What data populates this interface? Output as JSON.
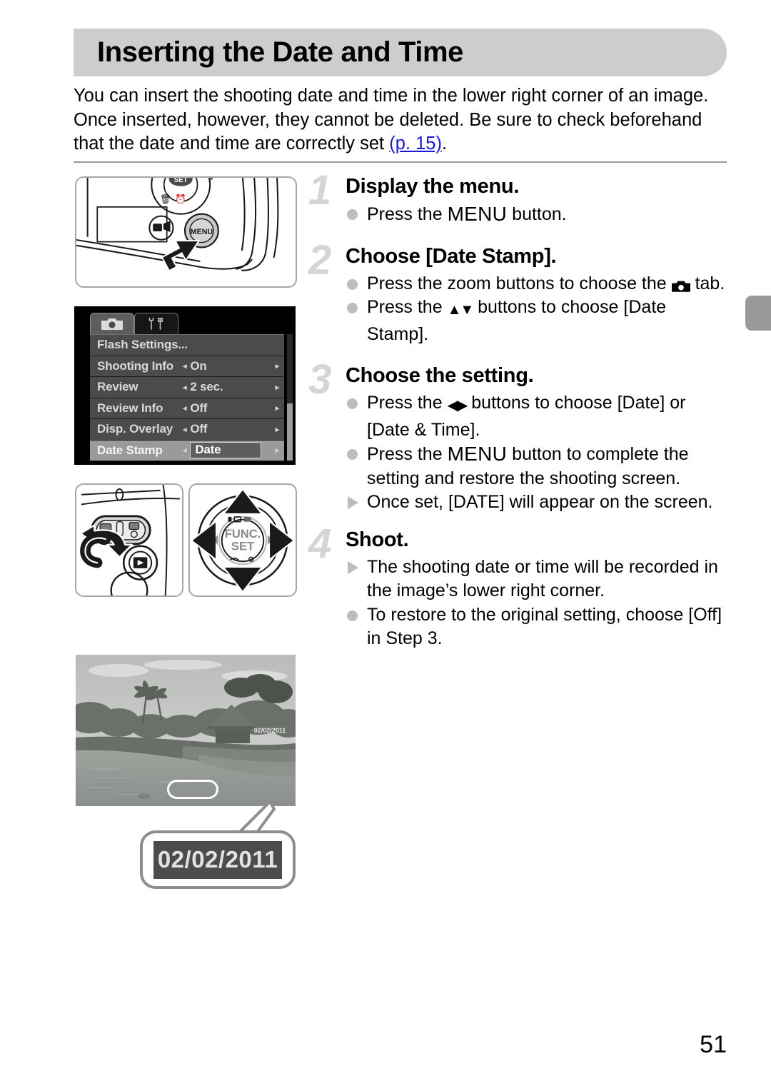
{
  "header": {
    "title": "Inserting the Date and Time"
  },
  "intro": {
    "text_before_link": "You can insert the shooting date and time in the lower right corner of an image. Once inserted, however, they cannot be deleted. Be sure to check beforehand that the date and time are correctly set ",
    "link": "(p. 15)",
    "text_after_link": "."
  },
  "menu_screen": {
    "tabs": [
      {
        "icon": "camera-icon",
        "active": true
      },
      {
        "icon": "tools-icon",
        "active": false
      }
    ],
    "rows": [
      {
        "label": "Flash Settings...",
        "value": "",
        "selected": false,
        "has_arrows": false
      },
      {
        "label": "Shooting Info",
        "value": "On",
        "selected": false,
        "has_arrows": true
      },
      {
        "label": "Review",
        "value": "2 sec.",
        "selected": false,
        "has_arrows": true
      },
      {
        "label": "Review Info",
        "value": "Off",
        "selected": false,
        "has_arrows": true
      },
      {
        "label": "Disp. Overlay",
        "value": "Off",
        "selected": false,
        "has_arrows": true
      },
      {
        "label": "Date Stamp",
        "value": "Date",
        "selected": true,
        "has_arrows": true
      }
    ],
    "arrow_left": "◂",
    "arrow_right": "▸"
  },
  "illustrations": {
    "camera_back": {
      "name": "camera-back-menu-button",
      "button_label": "MENU"
    },
    "zoom_lever": {
      "name": "zoom-lever-control"
    },
    "four_way": {
      "name": "four-way-control-pad",
      "center_line1": "FUNC.",
      "center_line2": "SET"
    }
  },
  "photo": {
    "stamp_overlay": "02/02/2011",
    "callout_date": "02/02/2011"
  },
  "steps": [
    {
      "number": "1",
      "heading": "Display the menu.",
      "bullets": [
        {
          "marker": "dot",
          "parts": [
            {
              "t": "text",
              "v": "Press the "
            },
            {
              "t": "menu",
              "v": "MENU"
            },
            {
              "t": "text",
              "v": " button."
            }
          ]
        }
      ]
    },
    {
      "number": "2",
      "heading": "Choose [Date Stamp].",
      "bullets": [
        {
          "marker": "dot",
          "parts": [
            {
              "t": "text",
              "v": "Press the zoom buttons to choose the "
            },
            {
              "t": "camicon",
              "v": ""
            },
            {
              "t": "text",
              "v": " tab."
            }
          ]
        },
        {
          "marker": "dot",
          "parts": [
            {
              "t": "text",
              "v": "Press the "
            },
            {
              "t": "updown",
              "v": "▲▼"
            },
            {
              "t": "text",
              "v": " buttons to choose [Date Stamp]."
            }
          ]
        }
      ]
    },
    {
      "number": "3",
      "heading": "Choose the setting.",
      "bullets": [
        {
          "marker": "dot",
          "parts": [
            {
              "t": "text",
              "v": "Press the "
            },
            {
              "t": "leftright",
              "v": "◀▶"
            },
            {
              "t": "text",
              "v": " buttons to choose [Date] or [Date & Time]."
            }
          ]
        },
        {
          "marker": "dot",
          "parts": [
            {
              "t": "text",
              "v": "Press the "
            },
            {
              "t": "menu",
              "v": "MENU"
            },
            {
              "t": "text",
              "v": " button to complete the setting and restore the shooting screen."
            }
          ]
        },
        {
          "marker": "triangle",
          "parts": [
            {
              "t": "text",
              "v": "Once set, [DATE] will appear on the screen."
            }
          ]
        }
      ]
    },
    {
      "number": "4",
      "heading": "Shoot.",
      "bullets": [
        {
          "marker": "triangle",
          "parts": [
            {
              "t": "text",
              "v": "The shooting date or time will be recorded in the image’s lower right corner."
            }
          ]
        },
        {
          "marker": "dot",
          "parts": [
            {
              "t": "text",
              "v": "To restore to the original setting, choose [Off] in Step 3."
            }
          ]
        }
      ]
    }
  ],
  "footer": {
    "page_number": "51"
  },
  "colors": {
    "title_bar": "#cdcdcd",
    "link": "#1a18d8",
    "step_number": "#d5d5d5",
    "bullet": "#bdbdbd",
    "edge_tab": "#9a9a9a"
  }
}
